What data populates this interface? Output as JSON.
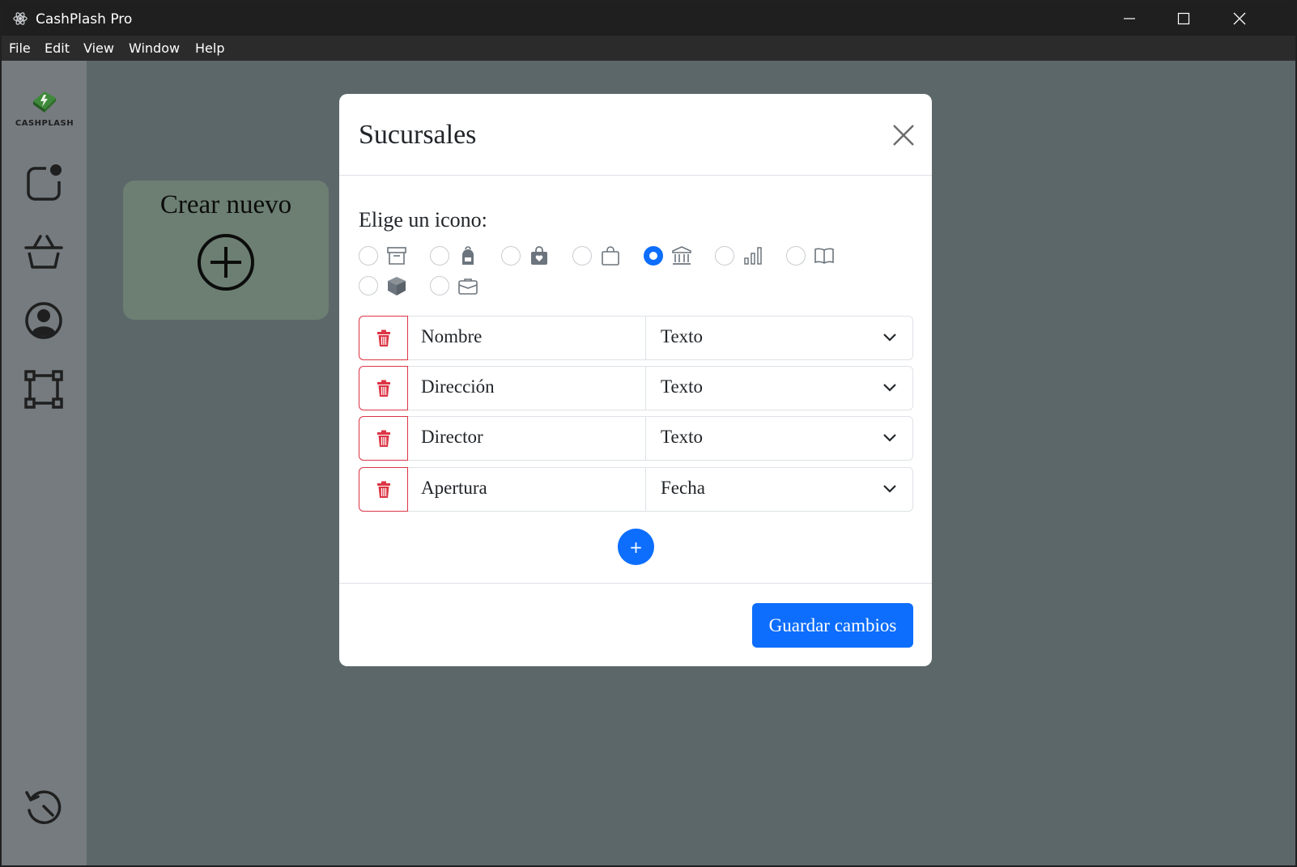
{
  "window": {
    "title": "CashPlash Pro",
    "controls": [
      "minimize",
      "maximize",
      "close"
    ]
  },
  "menu": {
    "items": [
      "File",
      "Edit",
      "View",
      "Window",
      "Help"
    ]
  },
  "sidebar": {
    "logo_text": "CASHPLASH",
    "items": [
      {
        "icon": "notification-square-icon"
      },
      {
        "icon": "basket-icon"
      },
      {
        "icon": "user-circle-icon"
      },
      {
        "icon": "bounding-box-icon"
      },
      {
        "icon": "history-icon"
      }
    ]
  },
  "main": {
    "create_card": {
      "title": "Crear nuevo",
      "icon": "plus-circle-icon"
    }
  },
  "modal": {
    "title": "Sucursales",
    "icon_label": "Elige un icono:",
    "icon_options": [
      {
        "icon": "archive-icon",
        "checked": false
      },
      {
        "icon": "backpack-icon",
        "checked": false
      },
      {
        "icon": "bag-heart-icon",
        "checked": false
      },
      {
        "icon": "bag-icon",
        "checked": false
      },
      {
        "icon": "bank-icon",
        "checked": true
      },
      {
        "icon": "bar-chart-icon",
        "checked": false
      },
      {
        "icon": "book-icon",
        "checked": false
      },
      {
        "icon": "box-icon",
        "checked": false
      },
      {
        "icon": "briefcase-icon",
        "checked": false
      }
    ],
    "fields": [
      {
        "name": "Nombre",
        "type": "Texto"
      },
      {
        "name": "Dirección",
        "type": "Texto"
      },
      {
        "name": "Director",
        "type": "Texto"
      },
      {
        "name": "Apertura",
        "type": "Fecha"
      }
    ],
    "add_label": "+",
    "save_label": "Guardar cambios"
  },
  "colors": {
    "primary": "#0d6efd",
    "danger": "#dc3545",
    "backdrop": "#5c6769",
    "sidebar": "#757b7f",
    "card": "#6c7f72"
  }
}
